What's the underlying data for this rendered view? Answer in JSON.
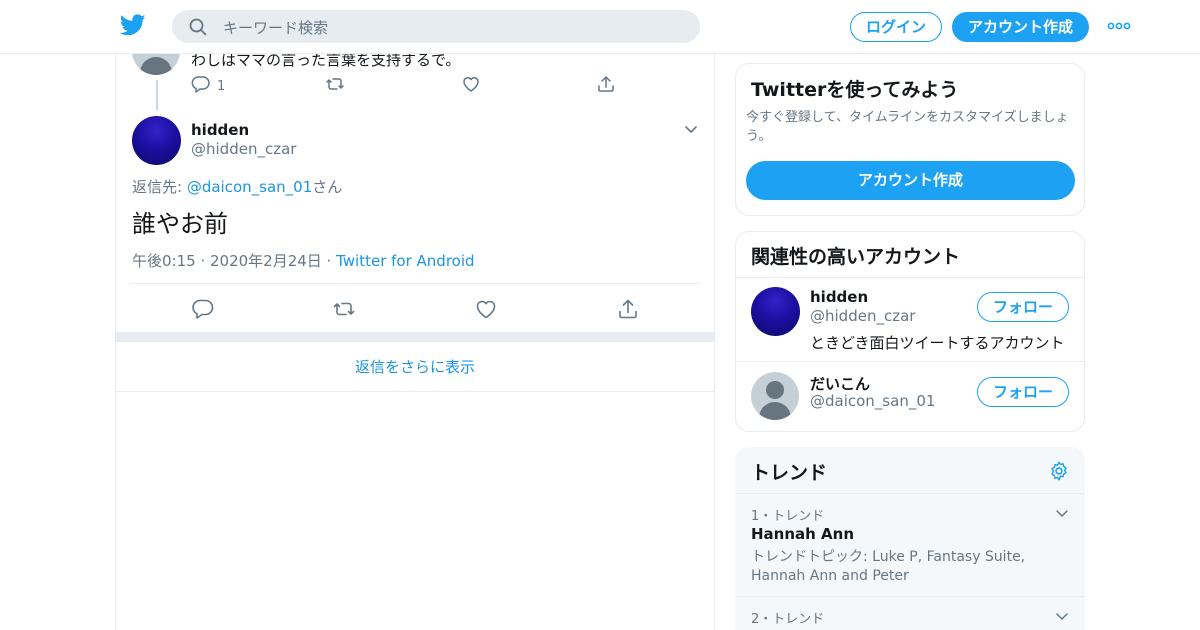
{
  "search": {
    "placeholder": "キーワード検索"
  },
  "header": {
    "login_label": "ログイン",
    "signup_label": "アカウント作成"
  },
  "prev_tweet": {
    "text": "わしはママの言った言葉を支持するで。",
    "reply_count": "1"
  },
  "tweet": {
    "name": "hidden",
    "handle": "@hidden_czar",
    "reply_prefix": "返信先: ",
    "reply_mention": "@daicon_san_01",
    "reply_suffix": "さん",
    "text": "誰やお前",
    "timestamp": "午後0:15 · 2020年2月24日 · ",
    "source": "Twitter for Android"
  },
  "show_more_label": "返信をさらに表示",
  "signup_card": {
    "title": "Twitterを使ってみよう",
    "subtitle": "今すぐ登録して、タイムラインをカスタマイズしましょう。",
    "button_label": "アカウント作成"
  },
  "related": {
    "title": "関連性の高いアカウント",
    "accounts": [
      {
        "name": "hidden",
        "handle": "@hidden_czar",
        "bio": "ときどき面白ツイートするアカウント",
        "follow_label": "フォロー"
      },
      {
        "name": "だいこん",
        "handle": "@daicon_san_01",
        "bio": "",
        "follow_label": "フォロー"
      }
    ]
  },
  "trends": {
    "title": "トレンド",
    "items": [
      {
        "rank": "1・トレンド",
        "name": "Hannah Ann",
        "desc": "トレンドトピック: Luke P, Fantasy Suite, Hannah Ann and Peter"
      },
      {
        "rank": "2・トレンド",
        "name": "",
        "desc": ""
      }
    ]
  },
  "colors": {
    "accent": "#1da1f2",
    "link": "#1b95e0",
    "muted": "#657786",
    "border": "#e6ecf0"
  },
  "icons": [
    "twitter-bird-icon",
    "search-icon",
    "more-icon",
    "reply-icon",
    "retweet-icon",
    "like-icon",
    "share-icon",
    "chevron-down-icon",
    "gear-icon"
  ]
}
